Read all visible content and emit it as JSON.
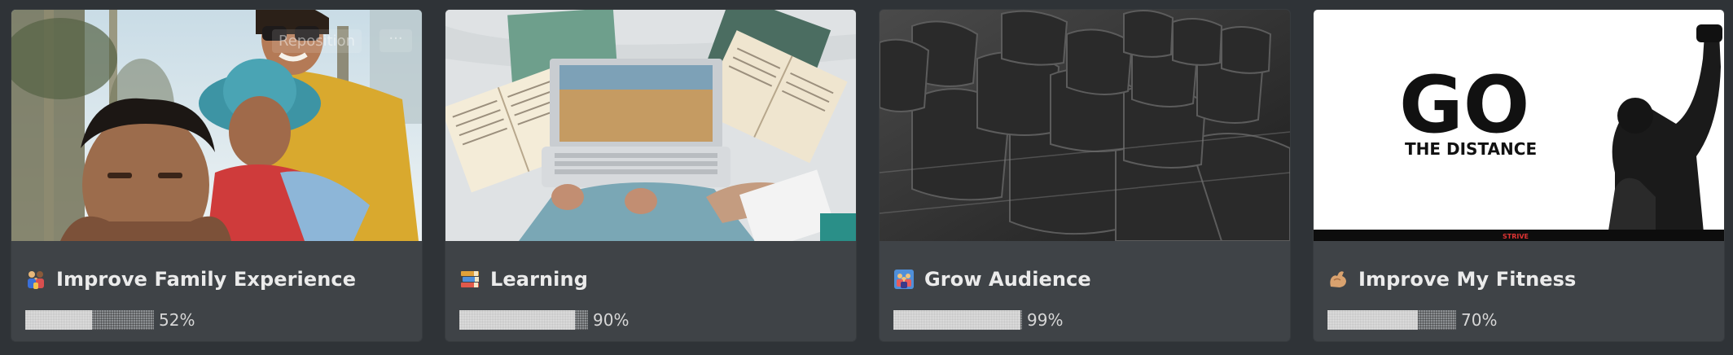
{
  "cards": [
    {
      "title": "Improve Family Experience",
      "icon": "family-emoji-icon",
      "progress_label": "52%",
      "progress": 52,
      "cover_action": "Reposition",
      "cover_more": "···"
    },
    {
      "title": "Learning",
      "icon": "books-emoji-icon",
      "progress_label": "90%",
      "progress": 90
    },
    {
      "title": "Grow Audience",
      "icon": "people-emoji-icon",
      "progress_label": "99%",
      "progress": 99
    },
    {
      "title": "Improve My Fitness",
      "icon": "flexed-biceps-emoji-icon",
      "progress_label": "70%",
      "progress": 70,
      "cover_text_main": "GO",
      "cover_text_sub": "THE DISTANCE",
      "cover_text_tag": "STRIVE"
    }
  ],
  "colors": {
    "background": "#2f3337",
    "card": "#3f4347",
    "text": "#ebebeb"
  }
}
